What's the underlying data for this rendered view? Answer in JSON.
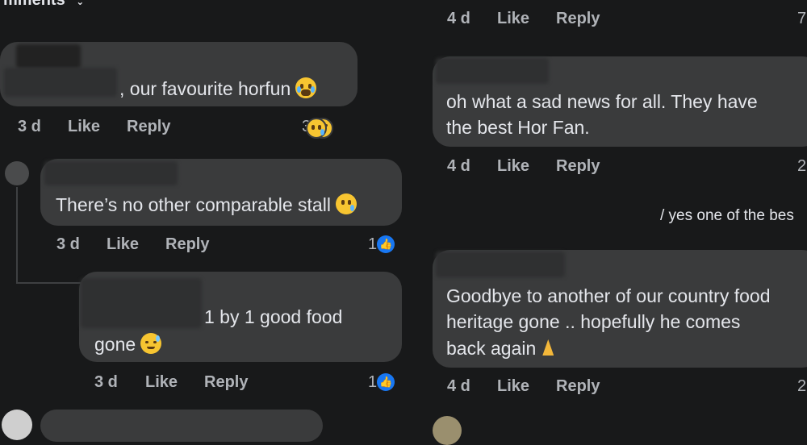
{
  "header": {
    "cut_label": "mments"
  },
  "left": {
    "c1": {
      "text": ", our favourite horfun",
      "time": "3 d",
      "like": "Like",
      "reply": "Reply",
      "react_count": "3"
    },
    "c2": {
      "text": "There’s no other comparable stall",
      "time": "3 d",
      "like": "Like",
      "reply": "Reply",
      "react_count": "1"
    },
    "c3": {
      "text_line1": "1 by 1 good food",
      "text_line2": "gone",
      "time": "3 d",
      "like": "Like",
      "reply": "Reply",
      "react_count": "1"
    }
  },
  "right": {
    "top_meta": {
      "time": "4 d",
      "like": "Like",
      "reply": "Reply",
      "count": "7"
    },
    "r1": {
      "line1": "oh what a sad news for all. They have",
      "line2": "the best Hor Fan.",
      "time": "4 d",
      "like": "Like",
      "reply": "Reply",
      "count": "2"
    },
    "r_partial": {
      "text": "/ yes one of the bes"
    },
    "r2": {
      "line1": "Goodbye to another of our country food",
      "line2": "heritage gone .. hopefully he comes",
      "line3": "back again",
      "time": "4 d",
      "like": "Like",
      "reply": "Reply",
      "count": "2"
    }
  },
  "colors": {
    "background": "#18191a",
    "bubble": "#3a3b3c",
    "text": "#e4e6eb",
    "meta": "#b0b3b8",
    "like_blue": "#1877f2"
  },
  "icons": [
    "crying-emoji",
    "laughing-emoji",
    "sad-emoji",
    "weary-emoji",
    "like-thumb-icon",
    "praying-hands-emoji"
  ]
}
